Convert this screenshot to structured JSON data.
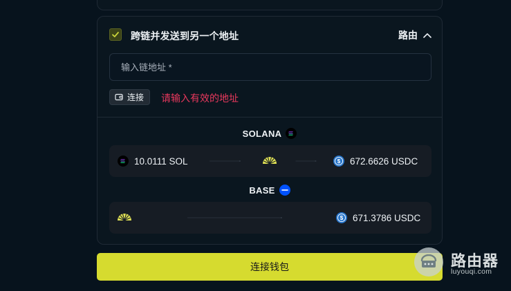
{
  "crosschain": {
    "checkbox_label": "跨链并发送到另一个地址",
    "checked": true,
    "route_label": "路由",
    "address_input": {
      "value": "",
      "placeholder": "输入链地址 *"
    },
    "connect_label": "连接",
    "error_message": "请输入有效的地址"
  },
  "routes": [
    {
      "chain": "SOLANA",
      "from_amount": "10.0111 SOL",
      "to_amount": "672.6626 USDC"
    },
    {
      "chain": "BASE",
      "to_amount": "671.3786 USDC"
    }
  ],
  "footer": {
    "wallet_button_label": "连接钱包"
  },
  "watermark": {
    "title": "路由器",
    "subtitle": "luyouqi.com"
  },
  "colors": {
    "background": "#07131d",
    "accent": "#d6db2f",
    "error": "#e8385d",
    "usdc": "#2775ca",
    "base": "#0052ff"
  }
}
